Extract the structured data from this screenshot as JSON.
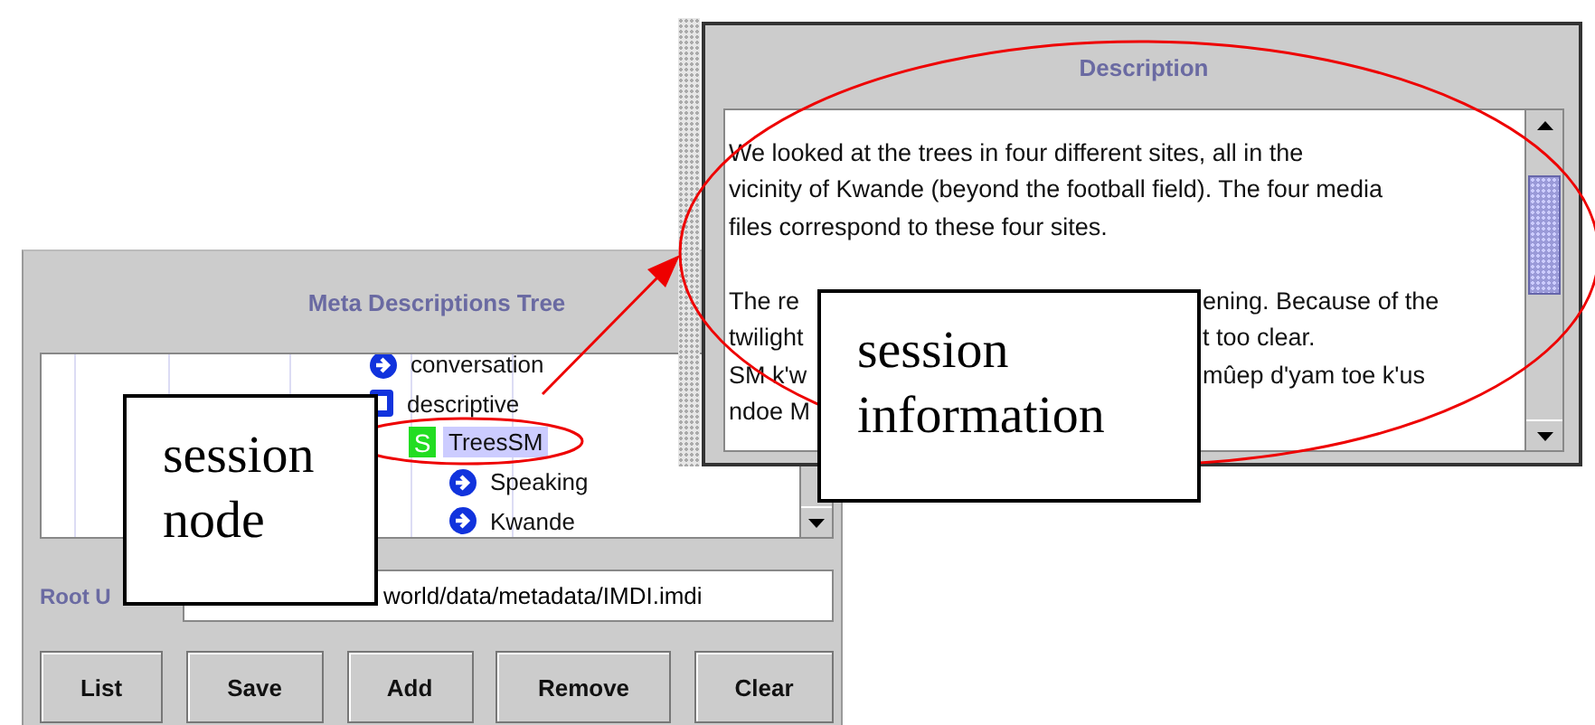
{
  "tree_window": {
    "title": "Meta Descriptions Tree",
    "tree": [
      {
        "label": "conversation",
        "kind": "arrow",
        "selected": false
      },
      {
        "label": "descriptive",
        "kind": "category",
        "selected": false,
        "children": [
          {
            "label": "TreesSM",
            "kind": "session",
            "badge": "S",
            "selected": true,
            "children": [
              {
                "label": "Speaking",
                "kind": "arrow",
                "selected": false
              },
              {
                "label": "Kwande",
                "kind": "arrow",
                "selected": false
              }
            ]
          }
        ]
      }
    ],
    "root_url": {
      "label": "Root U",
      "value": "world/data/metadata/IMDI.imdi"
    },
    "buttons": [
      "List",
      "Save",
      "Add",
      "Remove",
      "Clear"
    ]
  },
  "description_window": {
    "title": "Description",
    "paragraphs": [
      {
        "lines": [
          {
            "left": "We looked at the trees in four different sites, all in the"
          },
          {
            "left": "vicinity of Kwande (beyond the football field). The four media"
          },
          {
            "left": "files correspond to these four sites."
          }
        ]
      },
      {
        "lines": [
          {
            "left": "The re",
            "right": "ening. Because of the"
          },
          {
            "left": "twilight",
            "right": "t too clear."
          },
          {
            "left": "SM k'w",
            "right": "mûep d'yam toe k'us"
          },
          {
            "left": "ndoe M"
          }
        ]
      }
    ]
  },
  "callouts": [
    {
      "kind": "node",
      "text": "session node"
    },
    {
      "kind": "info",
      "text": "session information"
    }
  ]
}
